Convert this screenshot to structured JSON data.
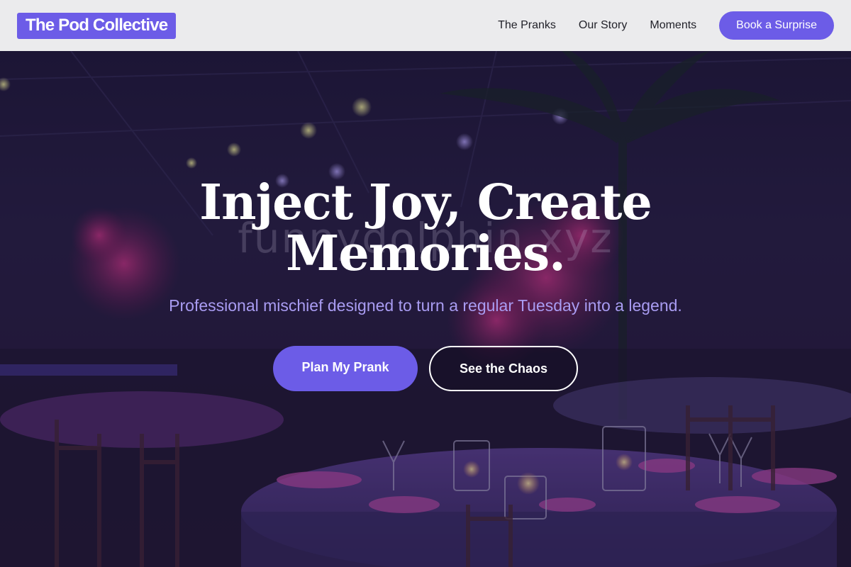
{
  "header": {
    "logo_text": "The Pod Collective",
    "nav": [
      {
        "label": "The Pranks"
      },
      {
        "label": "Our Story"
      },
      {
        "label": "Moments"
      }
    ],
    "cta_label": "Book a Surprise"
  },
  "hero": {
    "headline_line1": "Inject Joy, Create",
    "headline_line2": "Memories.",
    "subheadline": "Professional mischief designed to turn a regular Tuesday into a legend.",
    "primary_button": "Plan My Prank",
    "secondary_button": "See the Chaos",
    "watermark_text": "funnydolphin.xyz",
    "background_image": "banquet-hall-purple-lighting"
  },
  "colors": {
    "accent": "#6c5ce7",
    "header_bg": "#ebebed",
    "subheadline": "#a99cf2"
  }
}
